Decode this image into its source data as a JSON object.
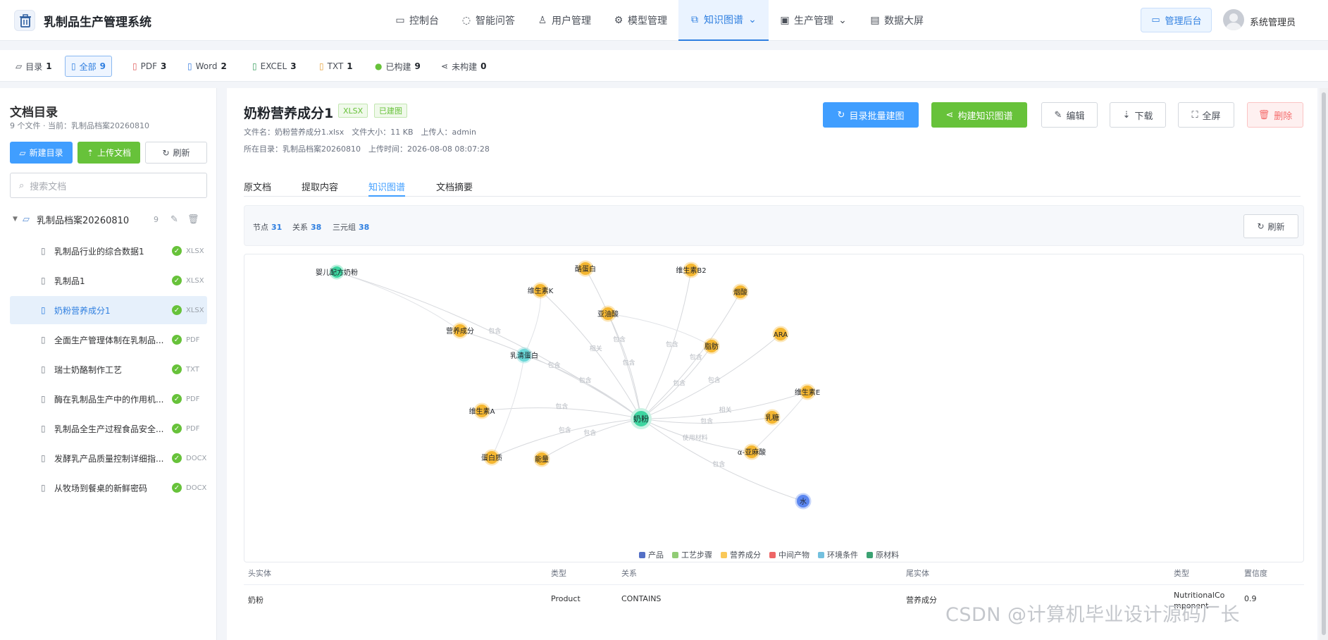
{
  "app": {
    "title": "乳制品生产管理系统"
  },
  "nav": [
    {
      "label": "控制台",
      "icon": "monitor-icon"
    },
    {
      "label": "智能问答",
      "icon": "chat-icon"
    },
    {
      "label": "用户管理",
      "icon": "user-icon"
    },
    {
      "label": "模型管理",
      "icon": "gear-icon"
    },
    {
      "label": "知识图谱",
      "icon": "graph-icon",
      "active": true
    },
    {
      "label": "生产管理",
      "icon": "box-icon"
    },
    {
      "label": "数据大屏",
      "icon": "chart-icon"
    }
  ],
  "header": {
    "admin_button": "管理后台",
    "user_name": "系统管理员"
  },
  "filters": [
    {
      "label": "目录",
      "count": "1"
    },
    {
      "label": "全部",
      "count": "9",
      "active": true
    },
    {
      "label": "PDF",
      "count": "3"
    },
    {
      "label": "Word",
      "count": "2"
    },
    {
      "label": "EXCEL",
      "count": "3"
    },
    {
      "label": "TXT",
      "count": "1"
    },
    {
      "label": "已构建",
      "count": "9"
    },
    {
      "label": "未构建",
      "count": "0"
    }
  ],
  "sidebar": {
    "title": "文档目录",
    "subtitle": "9 个文件 · 当前：乳制品档案20260810",
    "new_dir": "新建目录",
    "upload": "上传文档",
    "refresh": "刷新",
    "search_placeholder": "搜索文档",
    "folder": {
      "name": "乳制品档案20260810",
      "count": "9"
    },
    "files": [
      {
        "name": "乳制品行业的综合数据1",
        "type": "XLSX"
      },
      {
        "name": "乳制品1",
        "type": "XLSX"
      },
      {
        "name": "奶粉营养成分1",
        "type": "XLSX",
        "active": true
      },
      {
        "name": "全面生产管理体制在乳制品...",
        "type": "PDF"
      },
      {
        "name": "瑞士奶酪制作工艺",
        "type": "TXT"
      },
      {
        "name": "酶在乳制品生产中的作用机...",
        "type": "PDF"
      },
      {
        "name": "乳制品全生产过程食品安全...",
        "type": "PDF"
      },
      {
        "name": "发酵乳产品质量控制详细指...",
        "type": "DOCX"
      },
      {
        "name": "从牧场到餐桌的新鲜密码",
        "type": "DOCX"
      }
    ]
  },
  "doc": {
    "title": "奶粉营养成分1",
    "tag_type": "XLSX",
    "tag_status": "已建图",
    "meta_line1": "文件名：奶粉营养成分1.xlsx　文件大小：11 KB　上传人：admin",
    "meta_line2": "所在目录：乳制品档案20260810　上传时间：2026-08-08 08:07:28",
    "btn_batch": "目录批量建图",
    "btn_build": "构建知识图谱",
    "btn_edit": "编辑",
    "btn_download": "下载",
    "btn_fullscreen": "全屏",
    "btn_delete": "删除"
  },
  "tabs": [
    "原文档",
    "提取内容",
    "知识图谱",
    "文档摘要"
  ],
  "graph_stats": {
    "nodes_label": "节点",
    "nodes": "31",
    "relations_label": "关系",
    "relations": "38",
    "triples_label": "三元组",
    "triples": "38",
    "refresh": "刷新"
  },
  "graph": {
    "center": "奶粉",
    "nodes": [
      {
        "label": "婴儿配方奶粉",
        "type": "product"
      },
      {
        "label": "酪蛋白",
        "type": "nutrient"
      },
      {
        "label": "维生素B2",
        "type": "nutrient"
      },
      {
        "label": "维生素K",
        "type": "nutrient"
      },
      {
        "label": "烟酸",
        "type": "nutrient"
      },
      {
        "label": "亚油酸",
        "type": "nutrient"
      },
      {
        "label": "营养成分",
        "type": "nutrient"
      },
      {
        "label": "ARA",
        "type": "nutrient"
      },
      {
        "label": "脂肪",
        "type": "nutrient"
      },
      {
        "label": "乳清蛋白",
        "type": "environment"
      },
      {
        "label": "维生素E",
        "type": "nutrient"
      },
      {
        "label": "维生素A",
        "type": "nutrient"
      },
      {
        "label": "乳糖",
        "type": "nutrient"
      },
      {
        "label": "α-亚麻酸",
        "type": "nutrient"
      },
      {
        "label": "蛋白质",
        "type": "nutrient"
      },
      {
        "label": "能量",
        "type": "nutrient"
      },
      {
        "label": "水",
        "type": "material"
      }
    ],
    "edge_labels": [
      "包含",
      "相关",
      "使用材料"
    ],
    "legend": [
      {
        "label": "产品",
        "color": "#5470c6"
      },
      {
        "label": "工艺步骤",
        "color": "#91cc75"
      },
      {
        "label": "营养成分",
        "color": "#fac858"
      },
      {
        "label": "中间产物",
        "color": "#ee6666"
      },
      {
        "label": "环境条件",
        "color": "#73c0de"
      },
      {
        "label": "原材料",
        "color": "#3ba272"
      }
    ]
  },
  "table": {
    "headers": [
      "头实体",
      "类型",
      "关系",
      "尾实体",
      "类型",
      "置信度"
    ],
    "rows": [
      {
        "head": "奶粉",
        "head_type": "Product",
        "relation": "CONTAINS",
        "tail": "营养成分",
        "tail_type": "NutritionalComponent",
        "confidence": "0.9"
      }
    ]
  },
  "watermark": "CSDN @计算机毕业设计源码厂长"
}
